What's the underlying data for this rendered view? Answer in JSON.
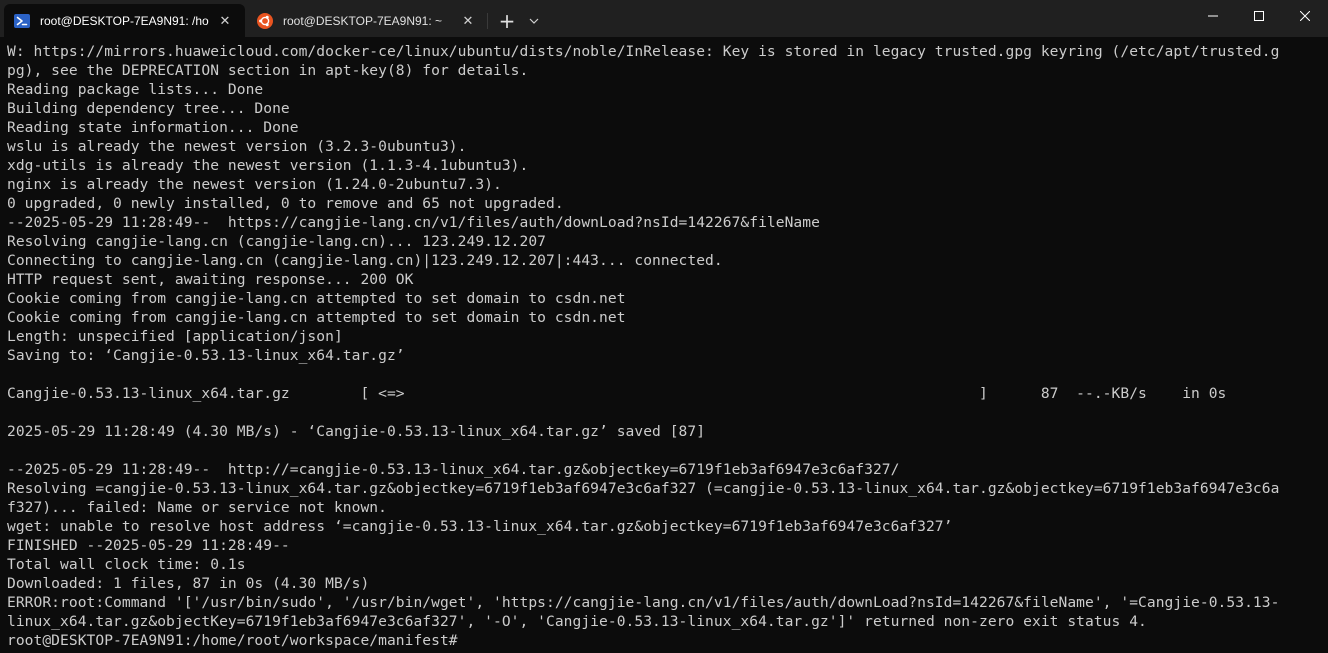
{
  "tabs": [
    {
      "title": "root@DESKTOP-7EA9N91: /ho",
      "icon": "powershell-icon",
      "active": true
    },
    {
      "title": "root@DESKTOP-7EA9N91: ~",
      "icon": "ubuntu-icon",
      "active": false
    }
  ],
  "controls": {
    "new_tab": "+",
    "close": "✕"
  },
  "colors": {
    "background": "#0c0c0c",
    "titlebar": "#202020",
    "text": "#cccccc",
    "powershell_blue": "#2b62c6",
    "ubuntu_orange": "#e95420"
  },
  "terminal": {
    "lines": [
      "W: https://mirrors.huaweicloud.com/docker-ce/linux/ubuntu/dists/noble/InRelease: Key is stored in legacy trusted.gpg keyring (/etc/apt/trusted.g",
      "pg), see the DEPRECATION section in apt-key(8) for details.",
      "Reading package lists... Done",
      "Building dependency tree... Done",
      "Reading state information... Done",
      "wslu is already the newest version (3.2.3-0ubuntu3).",
      "xdg-utils is already the newest version (1.1.3-4.1ubuntu3).",
      "nginx is already the newest version (1.24.0-2ubuntu7.3).",
      "0 upgraded, 0 newly installed, 0 to remove and 65 not upgraded.",
      "--2025-05-29 11:28:49--  https://cangjie-lang.cn/v1/files/auth/downLoad?nsId=142267&fileName",
      "Resolving cangjie-lang.cn (cangjie-lang.cn)... 123.249.12.207",
      "Connecting to cangjie-lang.cn (cangjie-lang.cn)|123.249.12.207|:443... connected.",
      "HTTP request sent, awaiting response... 200 OK",
      "Cookie coming from cangjie-lang.cn attempted to set domain to csdn.net",
      "Cookie coming from cangjie-lang.cn attempted to set domain to csdn.net",
      "Length: unspecified [application/json]",
      "Saving to: ‘Cangjie-0.53.13-linux_x64.tar.gz’",
      "",
      "Cangjie-0.53.13-linux_x64.tar.gz        [ <=>                                                                 ]      87  --.-KB/s    in 0s",
      "",
      "2025-05-29 11:28:49 (4.30 MB/s) - ‘Cangjie-0.53.13-linux_x64.tar.gz’ saved [87]",
      "",
      "--2025-05-29 11:28:49--  http://=cangjie-0.53.13-linux_x64.tar.gz&objectkey=6719f1eb3af6947e3c6af327/",
      "Resolving =cangjie-0.53.13-linux_x64.tar.gz&objectkey=6719f1eb3af6947e3c6af327 (=cangjie-0.53.13-linux_x64.tar.gz&objectkey=6719f1eb3af6947e3c6a",
      "f327)... failed: Name or service not known.",
      "wget: unable to resolve host address ‘=cangjie-0.53.13-linux_x64.tar.gz&objectkey=6719f1eb3af6947e3c6af327’",
      "FINISHED --2025-05-29 11:28:49--",
      "Total wall clock time: 0.1s",
      "Downloaded: 1 files, 87 in 0s (4.30 MB/s)",
      "ERROR:root:Command '['/usr/bin/sudo', '/usr/bin/wget', 'https://cangjie-lang.cn/v1/files/auth/downLoad?nsId=142267&fileName', '=Cangjie-0.53.13-",
      "linux_x64.tar.gz&objectKey=6719f1eb3af6947e3c6af327', '-O', 'Cangjie-0.53.13-linux_x64.tar.gz']' returned non-zero exit status 4.",
      "root@DESKTOP-7EA9N91:/home/root/workspace/manifest#"
    ]
  }
}
